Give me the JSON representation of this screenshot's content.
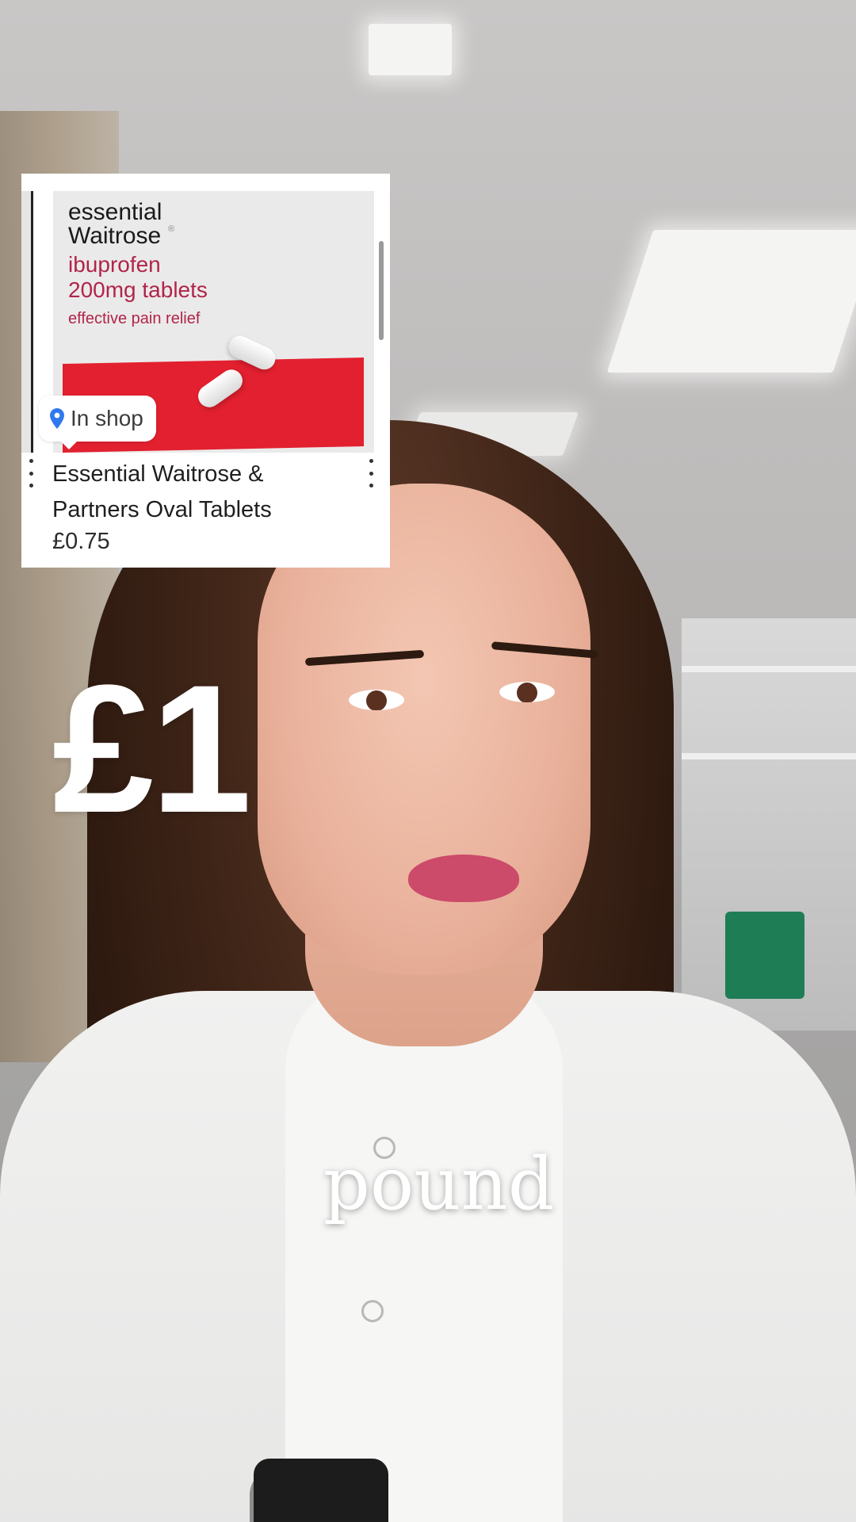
{
  "product_card": {
    "packaging": {
      "brand_line1": "essential",
      "brand_line2": "Waitrose",
      "drug": "ibuprofen",
      "strength": "200mg tablets",
      "tagline": "effective pain relief"
    },
    "badge": {
      "icon": "location-pin-icon",
      "label": "In shop"
    },
    "title": "Essential Waitrose & Partners Oval Tablets",
    "price": "£0.75"
  },
  "overlay": {
    "price_text": "£1",
    "caption": "pound"
  },
  "colors": {
    "pin_blue": "#2f78f0",
    "package_red": "#e2202f",
    "package_text": "#b0254a"
  }
}
